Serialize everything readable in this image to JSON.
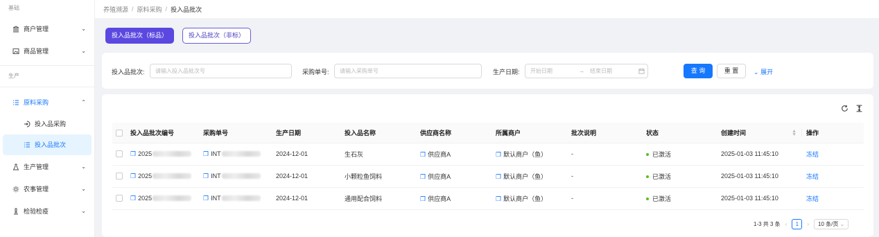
{
  "sidebar": {
    "groups": {
      "basic": "基础",
      "production": "生产"
    },
    "items": [
      {
        "label": "商户管理",
        "icon": "bank-icon"
      },
      {
        "label": "商品管理",
        "icon": "image-icon"
      },
      {
        "label": "原料采购",
        "icon": "list-icon"
      },
      {
        "label": "投入品采购",
        "icon": "login-icon"
      },
      {
        "label": "投入品批次",
        "icon": "list-icon"
      },
      {
        "label": "生产管理",
        "icon": "flask-icon"
      },
      {
        "label": "农事管理",
        "icon": "sun-icon"
      },
      {
        "label": "检验检疫",
        "icon": "microscope-icon"
      }
    ]
  },
  "breadcrumb": {
    "items": [
      "养殖溯源",
      "原料采购",
      "投入品批次"
    ],
    "separator": "/"
  },
  "tabs": [
    {
      "label": "投入品批次（标品）",
      "active": true
    },
    {
      "label": "投入品批次（非标）",
      "active": false
    }
  ],
  "filter": {
    "batch_label": "投入品批次:",
    "batch_placeholder": "请输入投入品批次号",
    "order_label": "采购单号:",
    "order_placeholder": "请输入采购单号",
    "date_label": "生产日期:",
    "start_placeholder": "开始日期",
    "arrow": "→",
    "end_placeholder": "结束日期",
    "query_label": "查 询",
    "reset_label": "重 置",
    "expand_label": "展开"
  },
  "table": {
    "columns": [
      "投入品批次编号",
      "采购单号",
      "生产日期",
      "投入品名称",
      "供应商名称",
      "所属商户",
      "批次说明",
      "状态",
      "创建时间",
      "操作"
    ],
    "rows": [
      {
        "batch_no": "2025",
        "order_no": "INT",
        "date": "2024-12-01",
        "name": "生石灰",
        "supplier": "供应商A",
        "merchant": "默认商户（鱼）",
        "note": "-",
        "status": "已激活",
        "created": "2025-01-03 11:45:10",
        "action": "冻结"
      },
      {
        "batch_no": "2025",
        "order_no": "INT",
        "date": "2024-12-01",
        "name": "小颗粒鱼饲料",
        "supplier": "供应商A",
        "merchant": "默认商户（鱼）",
        "note": "-",
        "status": "已激活",
        "created": "2025-01-03 11:45:10",
        "action": "冻结"
      },
      {
        "batch_no": "2025",
        "order_no": "INT",
        "date": "2024-12-01",
        "name": "通用配合饲料",
        "supplier": "供应商A",
        "merchant": "默认商户（鱼）",
        "note": "-",
        "status": "已激活",
        "created": "2025-01-03 11:45:10",
        "action": "冻结"
      }
    ]
  },
  "pagination": {
    "summary": "1-3 共 3 条",
    "current_page": "1",
    "page_size": "10 条/页"
  },
  "colors": {
    "primary": "#1677ff",
    "tab_active": "#5b48e0",
    "status_active": "#52c41a"
  }
}
